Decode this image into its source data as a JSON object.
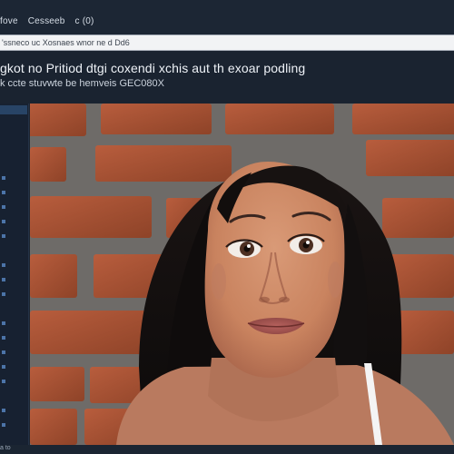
{
  "menu": {
    "items": [
      "fove",
      "Cesseeb",
      "c (0)"
    ]
  },
  "address_bar": {
    "text": "'ssneco uc Xosnaes wnor ne d Dd6"
  },
  "header": {
    "headline": "gkot no Pritiod dtgi coxendi xchis aut th exoar podling",
    "subline": "k ccte stuvwte be hemveis GEC080X"
  },
  "status": {
    "text": "a to"
  },
  "colors": {
    "background": "#1b2532",
    "address_bar": "#f2f3f5",
    "sidebar": "#172131",
    "accent": "#4c74a8"
  },
  "icons": [
    "sidebar-indicator-icon"
  ]
}
